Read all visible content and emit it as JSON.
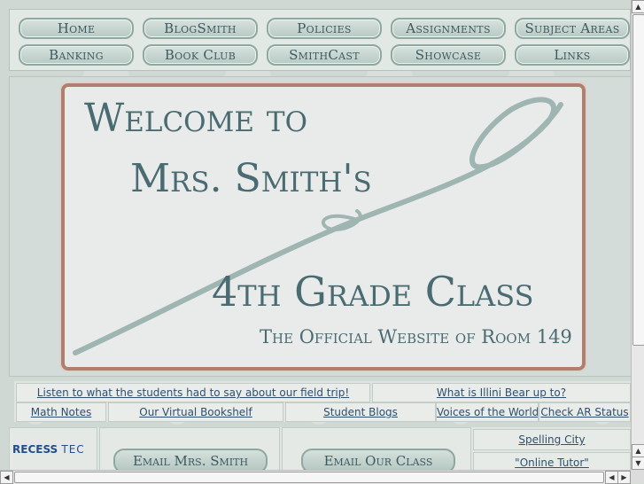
{
  "nav": {
    "row1": [
      "Home",
      "BlogSmith",
      "Policies",
      "Assignments",
      "Subject Areas"
    ],
    "row2": [
      "Banking",
      "Book Club",
      "SmithCast",
      "Showcase",
      "Links"
    ]
  },
  "banner": {
    "line1": "Welcome to",
    "line2": "Mrs. Smith's",
    "line3": "4th Grade Class",
    "line4": "The Official Website of Room 149"
  },
  "links": {
    "field_trip": "Listen to what the students had to say about our field trip!",
    "illini_bear": "What is Illini Bear up to?",
    "math_notes": "Math Notes",
    "bookshelf": "Our Virtual Bookshelf",
    "student_blogs": "Student Blogs",
    "voices": "Voices of the World",
    "ar_status": "Check AR Status"
  },
  "bottom": {
    "logo_recess": "RECESS",
    "logo_tec": "TEC",
    "email_teacher": "Email Mrs. Smith",
    "email_class": "Email Our Class",
    "spelling_city": "Spelling City",
    "online_tutor": "\"Online Tutor\""
  },
  "colors": {
    "accent_text": "#4a6b72",
    "banner_border": "#b07f6e",
    "link": "#2f4f6f"
  }
}
